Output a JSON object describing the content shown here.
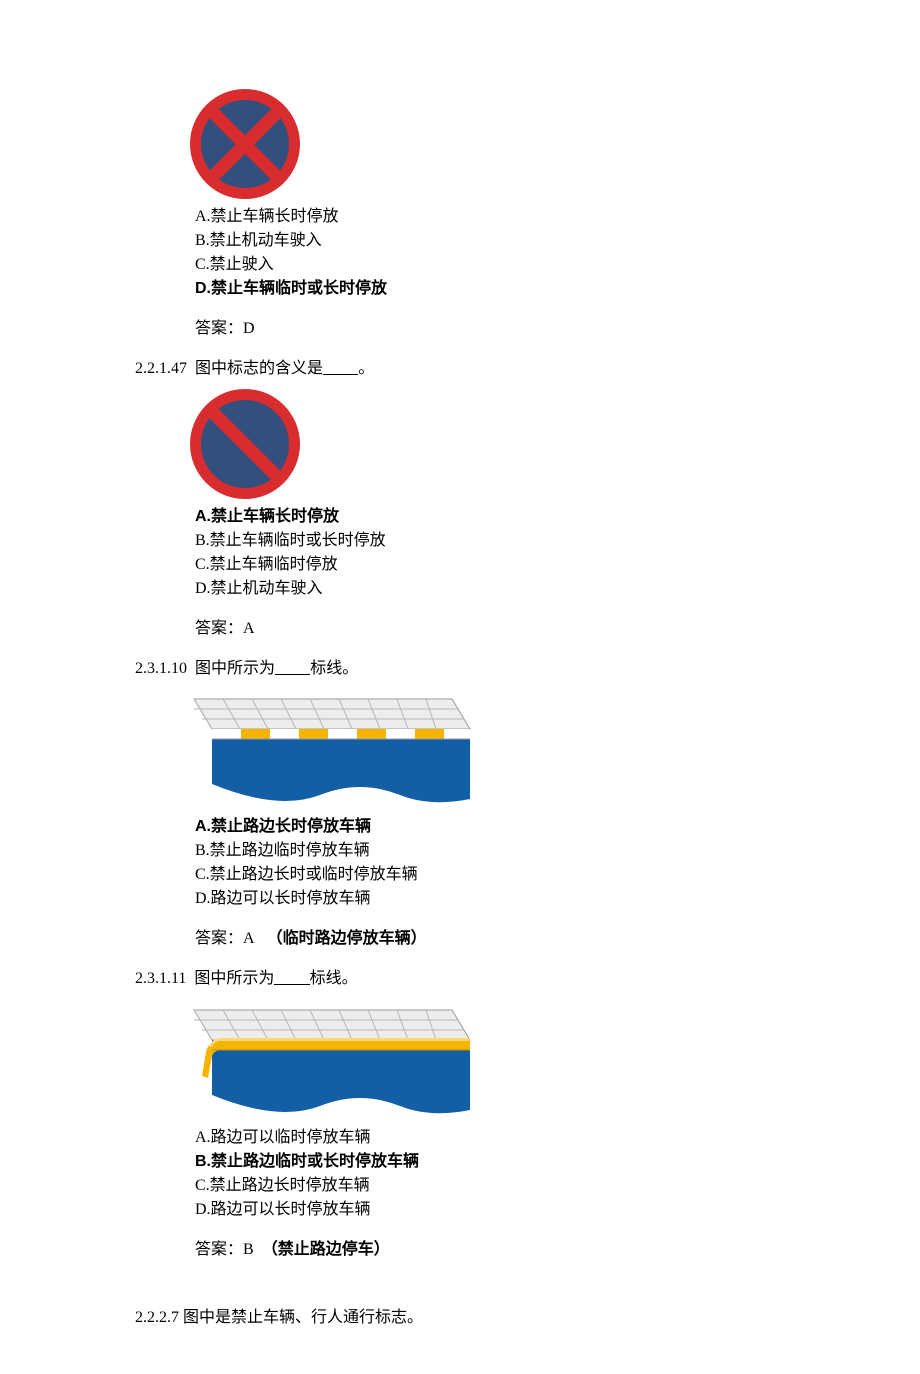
{
  "q1": {
    "opts": {
      "A": "A.禁止车辆长时停放",
      "B": "B.禁止机动车驶入",
      "C": "C.禁止驶入",
      "D": "D.禁止车辆临时或长时停放"
    },
    "answer": "答案：D"
  },
  "q2": {
    "number_prefix": "2.2.1.47",
    "number_suffix": "图中标志的含义是",
    "number_end": "。",
    "opts": {
      "A": "A.禁止车辆长时停放",
      "B": "B.禁止车辆临时或长时停放",
      "C": "C.禁止车辆临时停放",
      "D": "D.禁止机动车驶入"
    },
    "answer": "答案：A"
  },
  "q3": {
    "number_prefix": "2.3.1.10",
    "number_suffix1": "图中所示为",
    "number_suffix2": "标线。",
    "opts": {
      "A": "A.禁止路边长时停放车辆",
      "B": "B.禁止路边临时停放车辆",
      "C": "C.禁止路边长时或临时停放车辆",
      "D": "D.路边可以长时停放车辆"
    },
    "answer_prefix": "答案：A",
    "note": "（临时路边停放车辆）"
  },
  "q4": {
    "number_prefix": "2.3.1.11",
    "number_suffix1": "图中所示为",
    "number_suffix2": "标线。",
    "opts": {
      "A": "A.路边可以临时停放车辆",
      "B": "B.禁止路边临时或长时停放车辆",
      "C": "C.禁止路边长时停放车辆",
      "D": "D.路边可以长时停放车辆"
    },
    "answer_prefix": "答案：B",
    "note": "（禁止路边停车）"
  },
  "q5": {
    "line": "2.2.2.7  图中是禁止车辆、行人通行标志。"
  }
}
